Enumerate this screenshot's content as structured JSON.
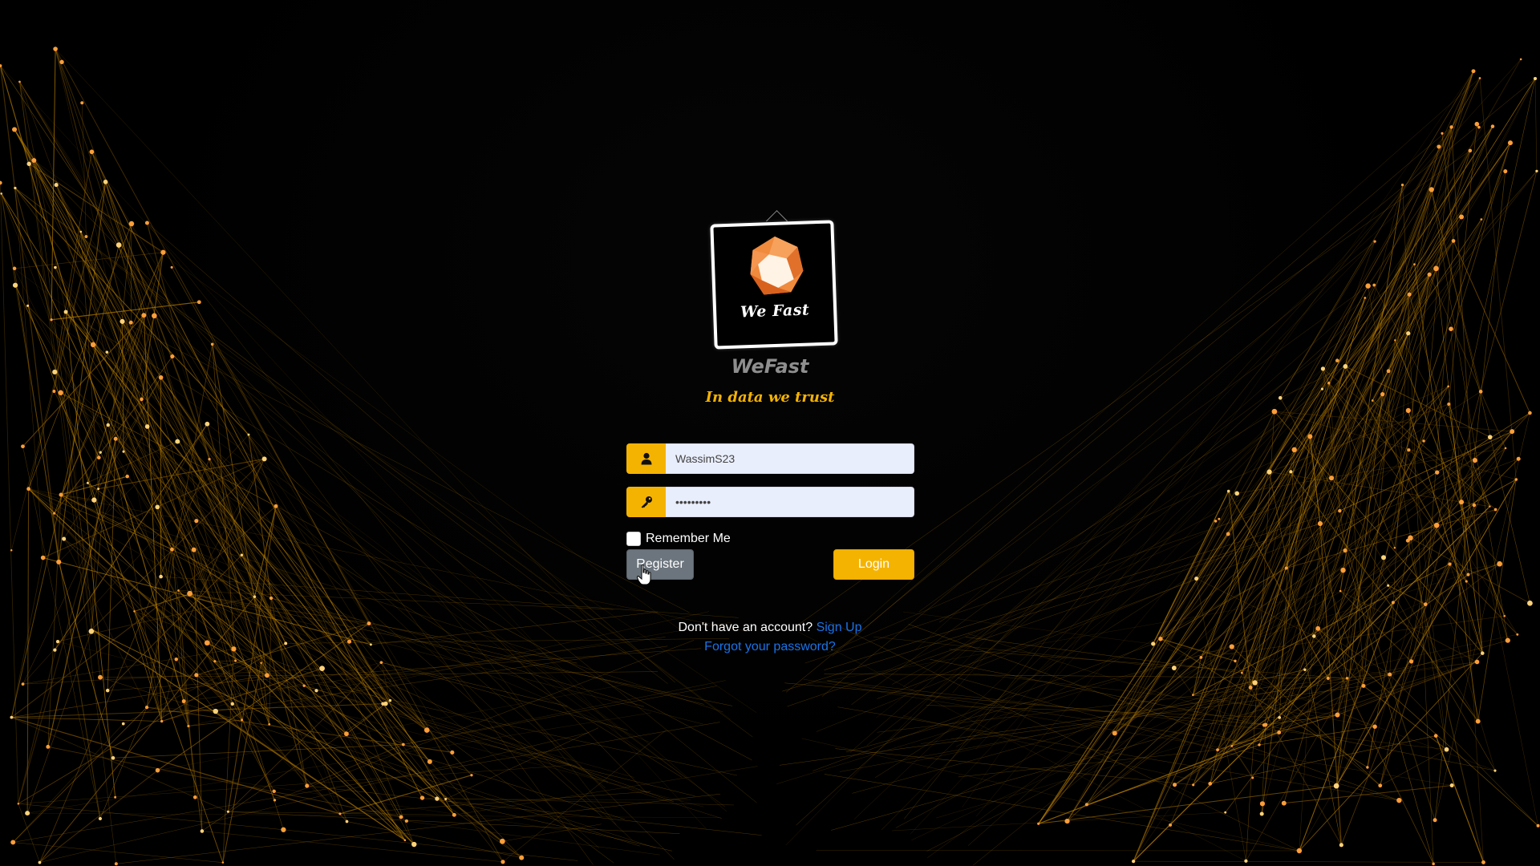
{
  "brand": {
    "logo_text": "We Fast",
    "name": "WeFast",
    "tagline": "In data we trust"
  },
  "form": {
    "username": {
      "value": "WassimS23",
      "icon": "user-icon"
    },
    "password": {
      "value": "•••••••••",
      "icon": "key-icon"
    },
    "remember_label": "Remember Me",
    "register_label": "Register",
    "login_label": "Login"
  },
  "footer": {
    "signup_prompt": "Don't have an account?",
    "signup_link": "Sign Up",
    "forgot_link": "Forgot your password?"
  },
  "colors": {
    "accent": "#f5b301",
    "background": "#000000",
    "link": "#1a73e8",
    "secondary_button": "#6c757d"
  }
}
